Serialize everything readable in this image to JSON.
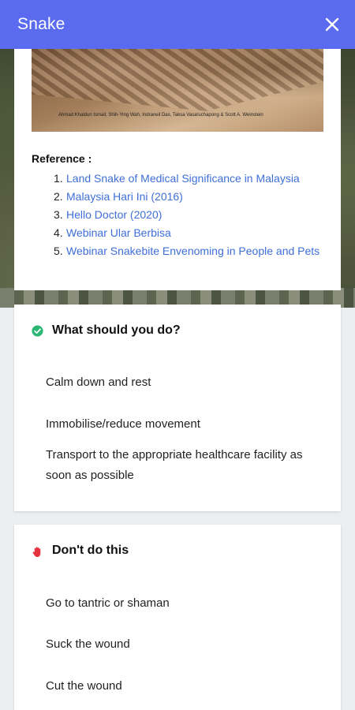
{
  "app_bar": {
    "title": "Snake",
    "close_icon": "close-icon"
  },
  "reference": {
    "image_credit": "Ahmad Khaldun Ismail, Shih-Ying Wah, Indraneil Das, Taksa Vasaruchapong & Scott A. Weinstein",
    "heading": "Reference :",
    "items": [
      {
        "num": "1.",
        "label": "Land Snake of Medical Significance in Malaysia"
      },
      {
        "num": "2.",
        "label": "Malaysia Hari Ini (2016)"
      },
      {
        "num": "3.",
        "label": "Hello Doctor (2020)"
      },
      {
        "num": "4.",
        "label": "Webinar Ular Berbisa"
      },
      {
        "num": "5.",
        "label": "Webinar Snakebite Envenoming in People and Pets"
      }
    ],
    "link_color": "#3f6fd8"
  },
  "do_card": {
    "icon": "check-circle-icon",
    "icon_color": "#2bb673",
    "title": "What should you do?",
    "items": [
      "Calm down and rest",
      "Immobilise/reduce movement",
      "Transport to the appropriate healthcare facility as soon as possible"
    ]
  },
  "dont_card": {
    "icon": "stop-hand-icon",
    "icon_color": "#e5323e",
    "title": "Don't do this",
    "items": [
      "Go to tantric or shaman",
      "Suck the wound",
      "Cut the wound"
    ]
  },
  "colors": {
    "app_bar": "#5b6bf0"
  }
}
